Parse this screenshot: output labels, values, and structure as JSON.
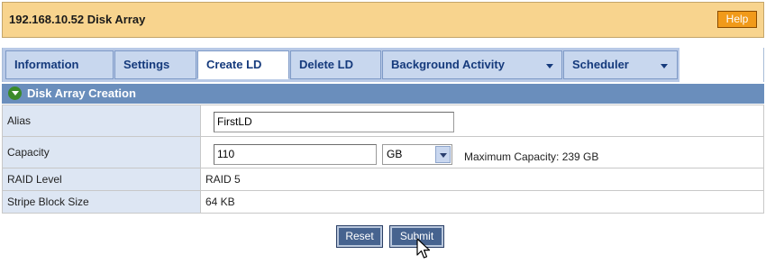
{
  "header": {
    "title": "192.168.10.52 Disk Array",
    "help_label": "Help"
  },
  "tabs": [
    {
      "label": "Information",
      "active": false,
      "has_dropdown": false
    },
    {
      "label": "Settings",
      "active": false,
      "has_dropdown": false
    },
    {
      "label": "Create LD",
      "active": true,
      "has_dropdown": false
    },
    {
      "label": "Delete LD",
      "active": false,
      "has_dropdown": false
    },
    {
      "label": "Background Activity",
      "active": false,
      "has_dropdown": true
    },
    {
      "label": "Scheduler",
      "active": false,
      "has_dropdown": true
    }
  ],
  "section": {
    "title": "Disk Array Creation",
    "icon": "collapse-circle-icon"
  },
  "form": {
    "alias": {
      "label": "Alias",
      "value": "FirstLD"
    },
    "capacity": {
      "label": "Capacity",
      "value": "110",
      "unit": "GB",
      "max_text": "Maximum Capacity: 239 GB"
    },
    "raid_level": {
      "label": "RAID Level",
      "value": "RAID 5"
    },
    "stripe_block_size": {
      "label": "Stripe Block Size",
      "value": "64 KB"
    }
  },
  "buttons": {
    "reset_label": "Reset",
    "submit_label": "Submit"
  },
  "colors": {
    "header_bg": "#f8d48e",
    "help_bg": "#f19a1a",
    "section_bg": "#6a8ebc",
    "label_bg": "#dde6f3",
    "tab_text": "#153a7c"
  }
}
